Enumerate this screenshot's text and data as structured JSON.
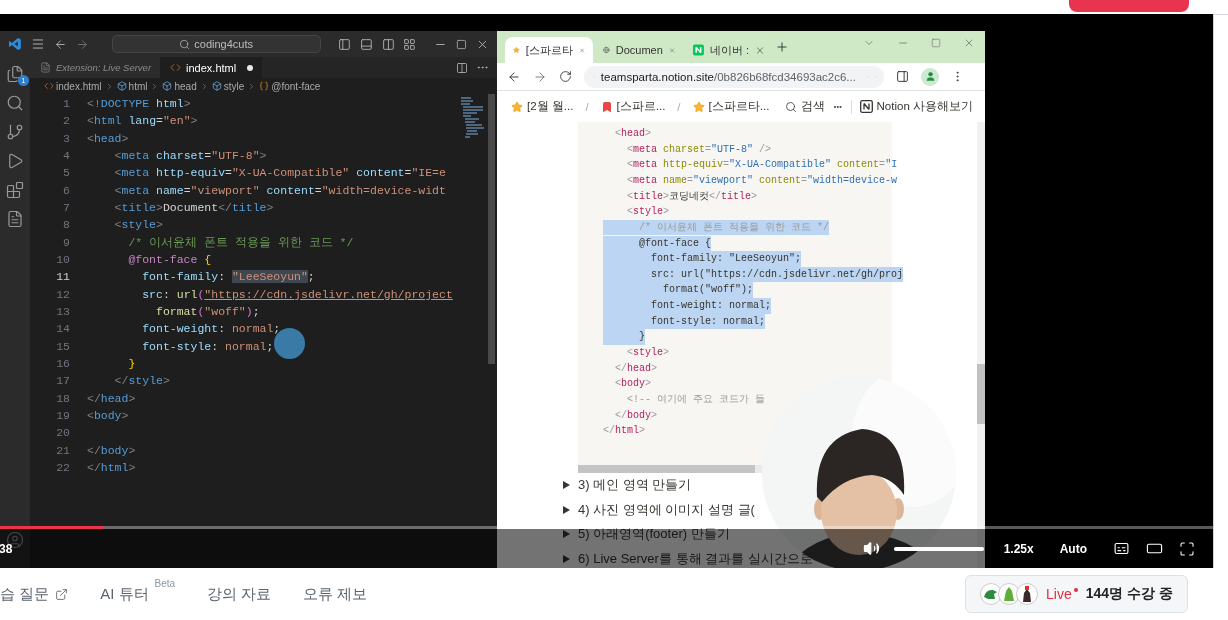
{
  "player": {
    "progress": {
      "level": 0.085
    },
    "time": "38",
    "volume": {
      "level": 1
    },
    "speed": "1.25x",
    "quality": "Auto"
  },
  "editor": {
    "search": "coding4cuts",
    "explorer_badge": "1",
    "tabs": [
      {
        "label": "Extension: Live Server",
        "selected": false,
        "modified": false
      },
      {
        "label": "index.html",
        "selected": true,
        "modified": true
      }
    ],
    "breadcrumbs": [
      {
        "label": "index.html",
        "kind": "file"
      },
      {
        "label": "html",
        "kind": "element"
      },
      {
        "label": "head",
        "kind": "element"
      },
      {
        "label": "style",
        "kind": "element"
      },
      {
        "label": "@font-face",
        "kind": "rule"
      }
    ],
    "lines": [
      {
        "number": "1",
        "active": false,
        "tokens": [
          {
            "kind": "p",
            "text": "<!"
          },
          {
            "kind": "tag",
            "text": "DOCTYPE "
          },
          {
            "kind": "attr",
            "text": "html"
          },
          {
            "kind": "p",
            "text": ">"
          }
        ]
      },
      {
        "number": "2",
        "active": false,
        "tokens": [
          {
            "kind": "p",
            "text": "<"
          },
          {
            "kind": "tag",
            "text": "html "
          },
          {
            "kind": "attr",
            "text": "lang"
          },
          {
            "kind": "txt",
            "text": "="
          },
          {
            "kind": "str",
            "text": "\"en\""
          },
          {
            "kind": "p",
            "text": ">"
          }
        ]
      },
      {
        "number": "3",
        "active": false,
        "tokens": [
          {
            "kind": "p",
            "text": "<"
          },
          {
            "kind": "tag",
            "text": "head"
          },
          {
            "kind": "p",
            "text": ">"
          }
        ]
      },
      {
        "number": "4",
        "active": false,
        "tokens": [
          {
            "kind": "p",
            "text": "    <"
          },
          {
            "kind": "tag",
            "text": "meta "
          },
          {
            "kind": "attr",
            "text": "charset"
          },
          {
            "kind": "txt",
            "text": "="
          },
          {
            "kind": "str",
            "text": "\"UTF-8\""
          },
          {
            "kind": "p",
            "text": ">"
          }
        ]
      },
      {
        "number": "5",
        "active": false,
        "tokens": [
          {
            "kind": "p",
            "text": "    <"
          },
          {
            "kind": "tag",
            "text": "meta "
          },
          {
            "kind": "attr",
            "text": "http-equiv"
          },
          {
            "kind": "txt",
            "text": "="
          },
          {
            "kind": "str",
            "text": "\"X-UA-Compatible\" "
          },
          {
            "kind": "attr",
            "text": "content"
          },
          {
            "kind": "txt",
            "text": "="
          },
          {
            "kind": "str",
            "text": "\"IE=e"
          }
        ]
      },
      {
        "number": "6",
        "active": false,
        "tokens": [
          {
            "kind": "p",
            "text": "    <"
          },
          {
            "kind": "tag",
            "text": "meta "
          },
          {
            "kind": "attr",
            "text": "name"
          },
          {
            "kind": "txt",
            "text": "="
          },
          {
            "kind": "str",
            "text": "\"viewport\" "
          },
          {
            "kind": "attr",
            "text": "content"
          },
          {
            "kind": "txt",
            "text": "="
          },
          {
            "kind": "str",
            "text": "\"width=device-widt"
          }
        ]
      },
      {
        "number": "7",
        "active": false,
        "tokens": [
          {
            "kind": "p",
            "text": "    <"
          },
          {
            "kind": "tag",
            "text": "title"
          },
          {
            "kind": "p",
            "text": ">"
          },
          {
            "kind": "txt",
            "text": "Document"
          },
          {
            "kind": "p",
            "text": "</"
          },
          {
            "kind": "tag",
            "text": "title"
          },
          {
            "kind": "p",
            "text": ">"
          }
        ]
      },
      {
        "number": "8",
        "active": false,
        "tokens": [
          {
            "kind": "p",
            "text": "    <"
          },
          {
            "kind": "tag",
            "text": "style"
          },
          {
            "kind": "p",
            "text": ">"
          }
        ]
      },
      {
        "number": "9",
        "active": false,
        "tokens": [
          {
            "kind": "cmt",
            "text": "      /* 이서윤체 폰트 적용을 위한 코드 */"
          }
        ]
      },
      {
        "number": "10",
        "active": false,
        "tokens": [
          {
            "kind": "kw",
            "text": "      @font-face "
          },
          {
            "kind": "brace",
            "text": "{"
          }
        ]
      },
      {
        "number": "11",
        "active": true,
        "tokens": [
          {
            "kind": "prop",
            "text": "        font-family"
          },
          {
            "kind": "txt",
            "text": ": "
          },
          {
            "kind": "strsel",
            "text": "\"LeeSeoyun\""
          },
          {
            "kind": "txt",
            "text": ";"
          }
        ]
      },
      {
        "number": "12",
        "active": false,
        "tokens": [
          {
            "kind": "prop",
            "text": "        src"
          },
          {
            "kind": "txt",
            "text": ": "
          },
          {
            "kind": "fn",
            "text": "url"
          },
          {
            "kind": "paren",
            "text": "("
          },
          {
            "kind": "url",
            "text": "\"https://cdn.jsdelivr.net/gh/project"
          }
        ]
      },
      {
        "number": "13",
        "active": false,
        "tokens": [
          {
            "kind": "fn",
            "text": "          format"
          },
          {
            "kind": "paren",
            "text": "("
          },
          {
            "kind": "str",
            "text": "\"woff\""
          },
          {
            "kind": "paren",
            "text": ")"
          },
          {
            "kind": "txt",
            "text": ";"
          }
        ]
      },
      {
        "number": "14",
        "active": false,
        "tokens": [
          {
            "kind": "prop",
            "text": "        font-weight"
          },
          {
            "kind": "txt",
            "text": ": "
          },
          {
            "kind": "str",
            "text": "normal"
          },
          {
            "kind": "txt",
            "text": ";"
          }
        ]
      },
      {
        "number": "15",
        "active": false,
        "tokens": [
          {
            "kind": "prop",
            "text": "        font-style"
          },
          {
            "kind": "txt",
            "text": ": "
          },
          {
            "kind": "str",
            "text": "normal"
          },
          {
            "kind": "txt",
            "text": ";"
          }
        ]
      },
      {
        "number": "16",
        "active": false,
        "tokens": [
          {
            "kind": "brace",
            "text": "      }"
          }
        ]
      },
      {
        "number": "17",
        "active": false,
        "tokens": [
          {
            "kind": "p",
            "text": "    </"
          },
          {
            "kind": "tag",
            "text": "style"
          },
          {
            "kind": "p",
            "text": ">"
          }
        ]
      },
      {
        "number": "18",
        "active": false,
        "tokens": [
          {
            "kind": "p",
            "text": "</"
          },
          {
            "kind": "tag",
            "text": "head"
          },
          {
            "kind": "p",
            "text": ">"
          }
        ]
      },
      {
        "number": "19",
        "active": false,
        "tokens": [
          {
            "kind": "p",
            "text": "<"
          },
          {
            "kind": "tag",
            "text": "body"
          },
          {
            "kind": "p",
            "text": ">"
          }
        ]
      },
      {
        "number": "20",
        "active": false
      },
      {
        "number": "21",
        "active": false,
        "tokens": [
          {
            "kind": "p",
            "text": "</"
          },
          {
            "kind": "tag",
            "text": "body"
          },
          {
            "kind": "p",
            "text": ">"
          }
        ]
      },
      {
        "number": "22",
        "active": false,
        "tokens": [
          {
            "kind": "p",
            "text": "</"
          },
          {
            "kind": "tag",
            "text": "html"
          },
          {
            "kind": "p",
            "text": ">"
          }
        ]
      }
    ]
  },
  "browser": {
    "tabs": [
      {
        "label": "[스파르타",
        "selected": true,
        "kind": "star"
      },
      {
        "label": "Documen",
        "selected": false,
        "kind": "globe"
      },
      {
        "label": "네이버 :",
        "selected": false,
        "kind": "naver"
      }
    ],
    "url": {
      "host": "teamsparta.notion.site",
      "path": "/0b826b68fcd34693ac2c6..."
    },
    "breadcrumbs": [
      {
        "label": "[2월 월...",
        "kind": "star"
      },
      {
        "separator": "/",
        "label": "[스파르...",
        "kind": "bookmark"
      },
      {
        "separator": "/",
        "label": "[스파르타...",
        "kind": "star"
      }
    ],
    "search": "검색",
    "try_notion": "Notion 사용해보기",
    "code_lines": [
      {
        "selected": false,
        "tokens": [
          {
            "kind": "p",
            "text": "  <"
          },
          {
            "kind": "tag",
            "text": "head"
          },
          {
            "kind": "p",
            "text": ">"
          }
        ]
      },
      {
        "selected": false,
        "tokens": [
          {
            "kind": "p",
            "text": "    <"
          },
          {
            "kind": "tag",
            "text": "meta "
          },
          {
            "kind": "attr",
            "text": "charset"
          },
          {
            "kind": "p",
            "text": "="
          },
          {
            "kind": "str",
            "text": "\"UTF-8\" "
          },
          {
            "kind": "p",
            "text": "/>"
          }
        ]
      },
      {
        "selected": false,
        "tokens": [
          {
            "kind": "p",
            "text": "    <"
          },
          {
            "kind": "tag",
            "text": "meta "
          },
          {
            "kind": "attr",
            "text": "http-equiv"
          },
          {
            "kind": "p",
            "text": "="
          },
          {
            "kind": "str",
            "text": "\"X-UA-Compatible\" "
          },
          {
            "kind": "attr",
            "text": "content"
          },
          {
            "kind": "p",
            "text": "="
          },
          {
            "kind": "str",
            "text": "\"I"
          }
        ]
      },
      {
        "selected": false,
        "tokens": [
          {
            "kind": "p",
            "text": "    <"
          },
          {
            "kind": "tag",
            "text": "meta "
          },
          {
            "kind": "attr",
            "text": "name"
          },
          {
            "kind": "p",
            "text": "="
          },
          {
            "kind": "str",
            "text": "\"viewport\" "
          },
          {
            "kind": "attr",
            "text": "content"
          },
          {
            "kind": "p",
            "text": "="
          },
          {
            "kind": "str",
            "text": "\"width=device-w"
          }
        ]
      },
      {
        "selected": false,
        "tokens": [
          {
            "kind": "p",
            "text": "    <"
          },
          {
            "kind": "tag",
            "text": "title"
          },
          {
            "kind": "p",
            "text": ">"
          },
          {
            "kind": "txt",
            "text": "코딩네컷"
          },
          {
            "kind": "p",
            "text": "</"
          },
          {
            "kind": "tag",
            "text": "title"
          },
          {
            "kind": "p",
            "text": ">"
          }
        ]
      },
      {
        "selected": false,
        "tokens": [
          {
            "kind": "p",
            "text": "    <"
          },
          {
            "kind": "tag",
            "text": "style"
          },
          {
            "kind": "p",
            "text": ">"
          }
        ]
      },
      {
        "selected": true,
        "tokens": [
          {
            "kind": "cmt",
            "text": "      /* 이서윤체 폰트 적용을 위한 코드 */"
          }
        ]
      },
      {
        "selected": true,
        "tokens": [
          {
            "kind": "txt",
            "text": "      @font-face {"
          }
        ]
      },
      {
        "selected": true,
        "tokens": [
          {
            "kind": "txt",
            "text": "        font-family: \"LeeSeoyun\";"
          }
        ]
      },
      {
        "selected": true,
        "tokens": [
          {
            "kind": "txt",
            "text": "        src: url(\"https://cdn.jsdelivr.net/gh/proj"
          }
        ]
      },
      {
        "selected": true,
        "tokens": [
          {
            "kind": "txt",
            "text": "          format(\"woff\");"
          }
        ]
      },
      {
        "selected": true,
        "tokens": [
          {
            "kind": "txt",
            "text": "        font-weight: normal;"
          }
        ]
      },
      {
        "selected": true,
        "tokens": [
          {
            "kind": "txt",
            "text": "        font-style: normal;"
          }
        ]
      },
      {
        "selected": true,
        "tokens": [
          {
            "kind": "txt",
            "text": "      }"
          }
        ]
      },
      {
        "selected": false,
        "tokens": [
          {
            "kind": "p",
            "text": "    <"
          },
          {
            "kind": "tag",
            "text": "style"
          },
          {
            "kind": "p",
            "text": ">"
          }
        ]
      },
      {
        "selected": false,
        "tokens": [
          {
            "kind": "p",
            "text": "  </"
          },
          {
            "kind": "tag",
            "text": "head"
          },
          {
            "kind": "p",
            "text": ">"
          }
        ]
      },
      {
        "selected": false,
        "tokens": [
          {
            "kind": "p",
            "text": "  <"
          },
          {
            "kind": "tag",
            "text": "body"
          },
          {
            "kind": "p",
            "text": ">"
          }
        ]
      },
      {
        "selected": false,
        "tokens": [
          {
            "kind": "cmt",
            "text": "    <!-- 여기에 주요 코드가 들"
          }
        ]
      },
      {
        "selected": false,
        "tokens": [
          {
            "kind": "p",
            "text": "  </"
          },
          {
            "kind": "tag",
            "text": "body"
          },
          {
            "kind": "p",
            "text": ">"
          }
        ]
      },
      {
        "selected": false,
        "tokens": [
          {
            "kind": "p",
            "text": "</"
          },
          {
            "kind": "tag",
            "text": "html"
          },
          {
            "kind": "p",
            "text": ">"
          }
        ]
      }
    ],
    "toggles": [
      "3) 메인 영역 만들기",
      "4) 사진 영역에 이미지 설명 글(",
      "5) 아래영역(footer) 만들기",
      "6) Live Server를 통해 결과를 실시간으로"
    ]
  },
  "tabs": [
    {
      "label": "습 질문",
      "kind": "external"
    },
    {
      "label": "AI 튜터",
      "kind": "beta",
      "badge": "Beta"
    },
    {
      "label": "강의 자료",
      "kind": "plain"
    },
    {
      "label": "오류 제보",
      "kind": "plain"
    }
  ],
  "live": {
    "label": "Live",
    "count": "144명 수강 중"
  }
}
